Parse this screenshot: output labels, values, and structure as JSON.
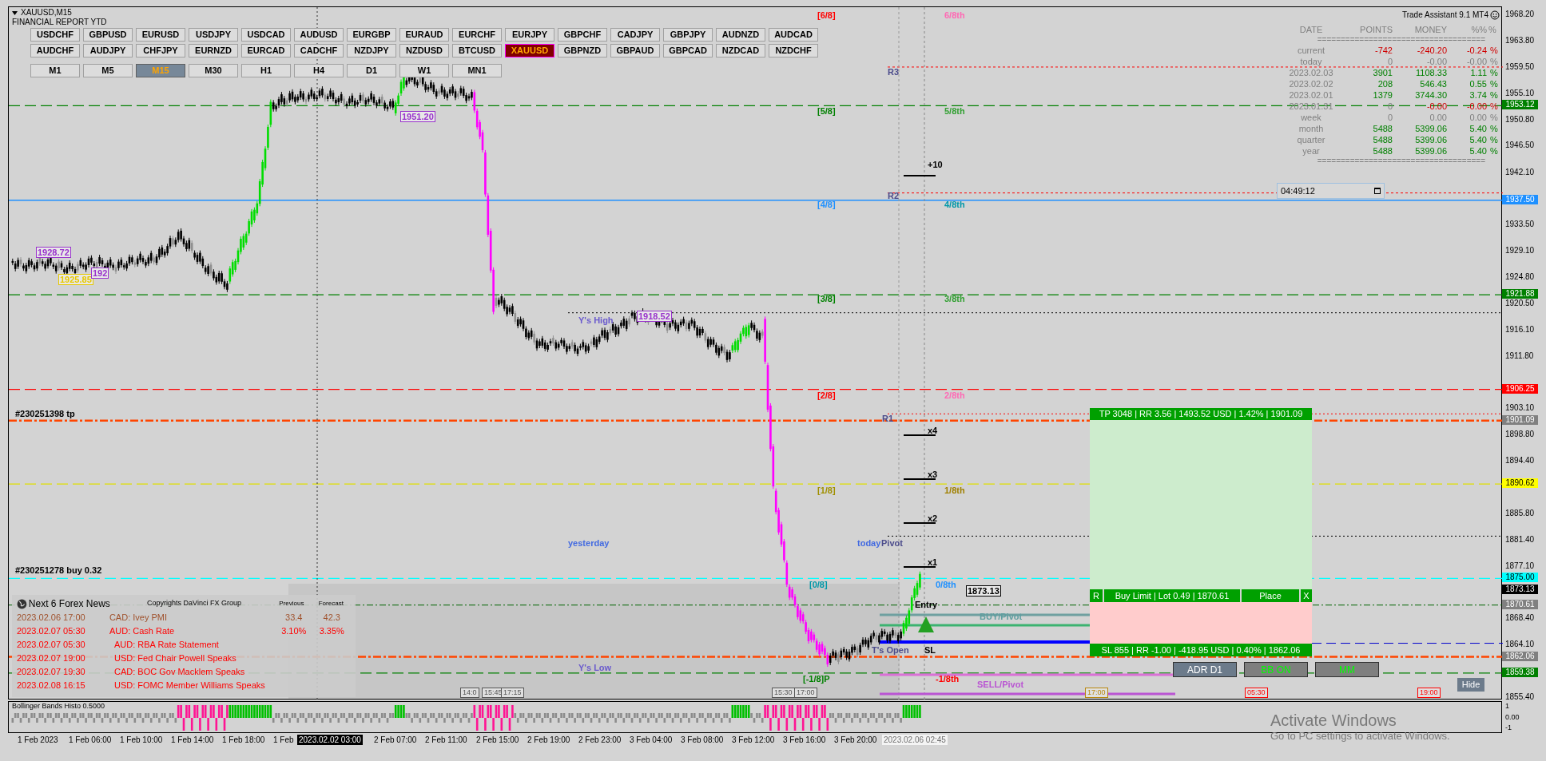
{
  "window": {
    "title": "XAUUSD,M15",
    "subtitle": "FINANCIAL REPORT YTD"
  },
  "symbols": [
    {
      "label": "USDCHF",
      "selected": false
    },
    {
      "label": "GBPUSD",
      "selected": false
    },
    {
      "label": "EURUSD",
      "selected": false
    },
    {
      "label": "USDJPY",
      "selected": false
    },
    {
      "label": "USDCAD",
      "selected": false
    },
    {
      "label": "AUDUSD",
      "selected": false
    },
    {
      "label": "EURGBP",
      "selected": false
    },
    {
      "label": "EURAUD",
      "selected": false
    },
    {
      "label": "EURCHF",
      "selected": false
    },
    {
      "label": "EURJPY",
      "selected": false
    },
    {
      "label": "GBPCHF",
      "selected": false
    },
    {
      "label": "CADJPY",
      "selected": false
    },
    {
      "label": "GBPJPY",
      "selected": false
    },
    {
      "label": "AUDNZD",
      "selected": false
    },
    {
      "label": "AUDCAD",
      "selected": false
    },
    {
      "label": "AUDCHF",
      "selected": false
    },
    {
      "label": "AUDJPY",
      "selected": false
    },
    {
      "label": "CHFJPY",
      "selected": false
    },
    {
      "label": "EURNZD",
      "selected": false
    },
    {
      "label": "EURCAD",
      "selected": false
    },
    {
      "label": "CADCHF",
      "selected": false
    },
    {
      "label": "NZDJPY",
      "selected": false
    },
    {
      "label": "NZDUSD",
      "selected": false
    },
    {
      "label": "BTCUSD",
      "selected": false
    },
    {
      "label": "XAUUSD",
      "selected": true
    },
    {
      "label": "GBPNZD",
      "selected": false
    },
    {
      "label": "GBPAUD",
      "selected": false
    },
    {
      "label": "GBPCAD",
      "selected": false
    },
    {
      "label": "NZDCAD",
      "selected": false
    },
    {
      "label": "NZDCHF",
      "selected": false
    }
  ],
  "timeframes": [
    {
      "label": "M1",
      "selected": false
    },
    {
      "label": "M5",
      "selected": false
    },
    {
      "label": "M15",
      "selected": true
    },
    {
      "label": "M30",
      "selected": false
    },
    {
      "label": "H1",
      "selected": false
    },
    {
      "label": "H4",
      "selected": false
    },
    {
      "label": "D1",
      "selected": false
    },
    {
      "label": "W1",
      "selected": false
    },
    {
      "label": "MN1",
      "selected": false
    }
  ],
  "report": {
    "title": "Trade Assistant 9.1 MT4",
    "columns": [
      "DATE",
      "POINTS",
      "MONEY",
      "%%",
      "%"
    ],
    "separator": "====================================",
    "rows": [
      {
        "date": "current",
        "points": {
          "text": "-742",
          "kind": "loss"
        },
        "money": {
          "text": "-240.20",
          "kind": "loss"
        },
        "pct": {
          "text": "-0.24",
          "kind": "loss"
        },
        "unit": {
          "text": "%",
          "kind": "loss"
        }
      },
      {
        "date": "today",
        "points": {
          "text": "0",
          "kind": "flat"
        },
        "money": {
          "text": "-0.00",
          "kind": "flat"
        },
        "pct": {
          "text": "-0.00",
          "kind": "flat"
        },
        "unit": {
          "text": "%",
          "kind": "flat"
        }
      },
      {
        "date": "2023.02.03",
        "points": {
          "text": "3901",
          "kind": "gain"
        },
        "money": {
          "text": "1108.33",
          "kind": "gain"
        },
        "pct": {
          "text": "1.11",
          "kind": "gain"
        },
        "unit": {
          "text": "%",
          "kind": "gain"
        }
      },
      {
        "date": "2023.02.02",
        "points": {
          "text": "208",
          "kind": "gain"
        },
        "money": {
          "text": "546.43",
          "kind": "gain"
        },
        "pct": {
          "text": "0.55",
          "kind": "gain"
        },
        "unit": {
          "text": "%",
          "kind": "gain"
        }
      },
      {
        "date": "2023.02.01",
        "points": {
          "text": "1379",
          "kind": "gain"
        },
        "money": {
          "text": "3744.30",
          "kind": "gain"
        },
        "pct": {
          "text": "3.74",
          "kind": "gain"
        },
        "unit": {
          "text": "%",
          "kind": "gain"
        }
      },
      {
        "date": "2023.01.31",
        "points": {
          "text": "0",
          "kind": "flat"
        },
        "money": {
          "text": "-0.00",
          "kind": "loss"
        },
        "pct": {
          "text": "-0.00",
          "kind": "loss"
        },
        "unit": {
          "text": "%",
          "kind": "loss"
        }
      },
      {
        "date": "week",
        "points": {
          "text": "0",
          "kind": "flat"
        },
        "money": {
          "text": "0.00",
          "kind": "flat"
        },
        "pct": {
          "text": "0.00",
          "kind": "flat"
        },
        "unit": {
          "text": "%",
          "kind": "flat"
        }
      },
      {
        "date": "month",
        "points": {
          "text": "5488",
          "kind": "gain"
        },
        "money": {
          "text": "5399.06",
          "kind": "gain"
        },
        "pct": {
          "text": "5.40",
          "kind": "gain"
        },
        "unit": {
          "text": "%",
          "kind": "gain"
        }
      },
      {
        "date": "quarter",
        "points": {
          "text": "5488",
          "kind": "gain"
        },
        "money": {
          "text": "5399.06",
          "kind": "gain"
        },
        "pct": {
          "text": "5.40",
          "kind": "gain"
        },
        "unit": {
          "text": "%",
          "kind": "gain"
        }
      },
      {
        "date": "year",
        "points": {
          "text": "5488",
          "kind": "gain"
        },
        "money": {
          "text": "5399.06",
          "kind": "gain"
        },
        "pct": {
          "text": "5.40",
          "kind": "gain"
        },
        "unit": {
          "text": "%",
          "kind": "gain"
        }
      }
    ]
  },
  "timer": {
    "value": "04:49:12"
  },
  "price_axis": {
    "labels": [
      "1968.20",
      "1963.80",
      "1959.50",
      "1955.10",
      "1950.80",
      "1946.50",
      "1942.10",
      "1933.50",
      "1929.10",
      "1924.80",
      "1920.50",
      "1916.10",
      "1911.80",
      "1903.10",
      "1898.80",
      "1894.40",
      "1885.80",
      "1881.40",
      "1877.10",
      "1868.40",
      "1864.10",
      "1855.40"
    ],
    "tags": [
      {
        "text": "1953.12",
        "color": "#008000",
        "kind": "murrey"
      },
      {
        "text": "1937.50",
        "color": "#1e90ff",
        "kind": "level"
      },
      {
        "text": "1921.88",
        "color": "#008000",
        "kind": "murrey"
      },
      {
        "text": "1906.25",
        "color": "#ff0000",
        "kind": "murrey"
      },
      {
        "text": "1901.09",
        "color": "#808080",
        "kind": "trade"
      },
      {
        "text": "1890.62",
        "color": "#ffff00",
        "kind": "murrey"
      },
      {
        "text": "1875.00",
        "color": "#00ffff",
        "kind": "murrey"
      },
      {
        "text": "1873.13",
        "color": "#000000",
        "kind": "price"
      },
      {
        "text": "1870.61",
        "color": "#808080",
        "kind": "order"
      },
      {
        "text": "1862.06",
        "color": "#808080",
        "kind": "trade"
      },
      {
        "text": "1859.38",
        "color": "#008000",
        "kind": "murrey"
      }
    ]
  },
  "chart_labels": [
    {
      "text": "[6/8]",
      "color": "#ff0000",
      "kind": "text"
    },
    {
      "text": "6/8th",
      "color": "#ff69b4",
      "kind": "text"
    },
    {
      "text": "R3",
      "color": "#4b4b8b",
      "kind": "text"
    },
    {
      "text": "+10",
      "color": "#000000",
      "kind": "text"
    },
    {
      "text": "[5/8]",
      "color": "#008000",
      "kind": "text"
    },
    {
      "text": "5/8th",
      "color": "#32a032",
      "kind": "text"
    },
    {
      "text": "R2",
      "color": "#4b4b8b",
      "kind": "text"
    },
    {
      "text": "[4/8]",
      "color": "#1e90ff",
      "kind": "text"
    },
    {
      "text": "4/8th",
      "color": "#0098a8",
      "kind": "text"
    },
    {
      "text": "1928.72",
      "color": "#9932cc",
      "kind": "box"
    },
    {
      "text": "1925.85",
      "color": "#e6c800",
      "kind": "box"
    },
    {
      "text": "192",
      "color": "#9932cc",
      "kind": "box"
    },
    {
      "text": "1951.20",
      "color": "#9932cc",
      "kind": "box"
    },
    {
      "text": "[3/8]",
      "color": "#008000",
      "kind": "text"
    },
    {
      "text": "3/8th",
      "color": "#32a032",
      "kind": "text"
    },
    {
      "text": "Y's High",
      "color": "#6a5acd",
      "kind": "text"
    },
    {
      "text": "1918.52",
      "color": "#9932cc",
      "kind": "box"
    },
    {
      "text": "[2/8]",
      "color": "#ff0000",
      "kind": "text"
    },
    {
      "text": "2/8th",
      "color": "#ff69b4",
      "kind": "text"
    },
    {
      "text": "#230251398 tp",
      "color": "#000000",
      "kind": "text"
    },
    {
      "text": "R1",
      "color": "#4b4b8b",
      "kind": "text"
    },
    {
      "text": "x4",
      "color": "#000000",
      "kind": "text"
    },
    {
      "text": "x3",
      "color": "#000000",
      "kind": "text"
    },
    {
      "text": "x2",
      "color": "#000000",
      "kind": "text"
    },
    {
      "text": "x1",
      "color": "#000000",
      "kind": "text"
    },
    {
      "text": "[1/8]",
      "color": "#a09000",
      "kind": "text"
    },
    {
      "text": "1/8th",
      "color": "#a08000",
      "kind": "text"
    },
    {
      "text": "yesterday",
      "color": "#4169e1",
      "kind": "text"
    },
    {
      "text": "today",
      "color": "#4169e1",
      "kind": "text"
    },
    {
      "text": "Pivot",
      "color": "#4b4b8b",
      "kind": "text"
    },
    {
      "text": "#230251278 buy 0.32",
      "color": "#000000",
      "kind": "text"
    },
    {
      "text": "[0/8]",
      "color": "#0098a8",
      "kind": "text"
    },
    {
      "text": "0/8th",
      "color": "#1e90ff",
      "kind": "text"
    },
    {
      "text": "1873.13",
      "color": "#000000",
      "kind": "box"
    },
    {
      "text": "Entry",
      "color": "#000000",
      "kind": "text"
    },
    {
      "text": "BUY/Pivot",
      "color": "#5f9ea0",
      "kind": "text"
    },
    {
      "text": "T's Open",
      "color": "#4b4b8b",
      "kind": "text"
    },
    {
      "text": "SL",
      "color": "#000000",
      "kind": "text"
    },
    {
      "text": "Y's Low",
      "color": "#6a5acd",
      "kind": "text"
    },
    {
      "text": "[-1/8]P",
      "color": "#008000",
      "kind": "text"
    },
    {
      "text": "-1/8th",
      "color": "#ff0000",
      "kind": "text"
    },
    {
      "text": "SELL/Pivot",
      "color": "#ba55d3",
      "kind": "text"
    }
  ],
  "time_flags": [
    {
      "text": "14:0",
      "color": "#555555"
    },
    {
      "text": "15:45",
      "color": "#555555"
    },
    {
      "text": "17:15",
      "color": "#555555"
    },
    {
      "text": "15:30",
      "color": "#555555"
    },
    {
      "text": "17:00",
      "color": "#555555"
    },
    {
      "text": "17:00",
      "color": "#b8860b"
    },
    {
      "text": "05:30",
      "color": "#ff0000"
    },
    {
      "text": "19:00",
      "color": "#ff0000"
    }
  ],
  "trade": {
    "tp": "TP 3048 | RR 3.56 | 1493.52 USD | 1.42% | 1901.09",
    "reset": "R",
    "order": "Buy Limit | Lot 0.49 | 1870.61",
    "place": "Place",
    "close": "X",
    "sl": "SL 855 | RR -1.00 | -418.95 USD | 0.40% | 1862.06"
  },
  "panel_buttons": [
    {
      "label": "ADR D1",
      "kind": "plain"
    },
    {
      "label": "BB ON",
      "kind": "toggle"
    },
    {
      "label": "MM",
      "kind": "toggle"
    }
  ],
  "hide_button": "Hide",
  "news": {
    "title": "Next 6 Forex News",
    "credit": "Copyrights DaVinci FX Group",
    "columns": [
      "Previous",
      "Forecast"
    ],
    "rows": [
      {
        "time": "2023.02.06 17:00",
        "event": "CAD: Ivey PMI",
        "previous": "33.4",
        "forecast": "42.3",
        "color": "#a0522d"
      },
      {
        "time": "2023.02.07 05:30",
        "event": "AUD: Cash Rate",
        "previous": "3.10%",
        "forecast": "3.35%",
        "color": "#ff0000"
      },
      {
        "time": "2023.02.07 05:30",
        "event": "AUD: RBA Rate Statement",
        "color": "#ff0000"
      },
      {
        "time": "2023.02.07 19:00",
        "event": "USD: Fed Chair Powell Speaks",
        "color": "#ff0000"
      },
      {
        "time": "2023.02.07 19:30",
        "event": "CAD: BOC Gov Macklem Speaks",
        "color": "#ff0000"
      },
      {
        "time": "2023.02.08 16:15",
        "event": "USD: FOMC Member Williams Speaks",
        "color": "#ff0000"
      }
    ]
  },
  "indicator": {
    "title": "Bollinger Bands Histo 0.5000",
    "axis": [
      "1",
      "0.00",
      "-1"
    ]
  },
  "time_axis": {
    "labels": [
      "1 Feb 2023",
      "1 Feb 06:00",
      "1 Feb 10:00",
      "1 Feb 14:00",
      "1 Feb 18:00",
      "1 Feb",
      "2 Feb 07:00",
      "2 Feb 11:00",
      "2 Feb 15:00",
      "2 Feb 19:00",
      "2 Feb 23:00",
      "3 Feb 04:00",
      "3 Feb 08:00",
      "3 Feb 12:00",
      "3 Feb 16:00",
      "3 Feb 20:00"
    ],
    "markers": [
      {
        "text": "2023.02.02 03:00",
        "kind": "dark"
      },
      {
        "text": "2023.02.06 02:45",
        "kind": "light"
      }
    ]
  },
  "activation_notice": {
    "title": "Activate Windows",
    "text": "Go to PC settings to activate Windows."
  }
}
